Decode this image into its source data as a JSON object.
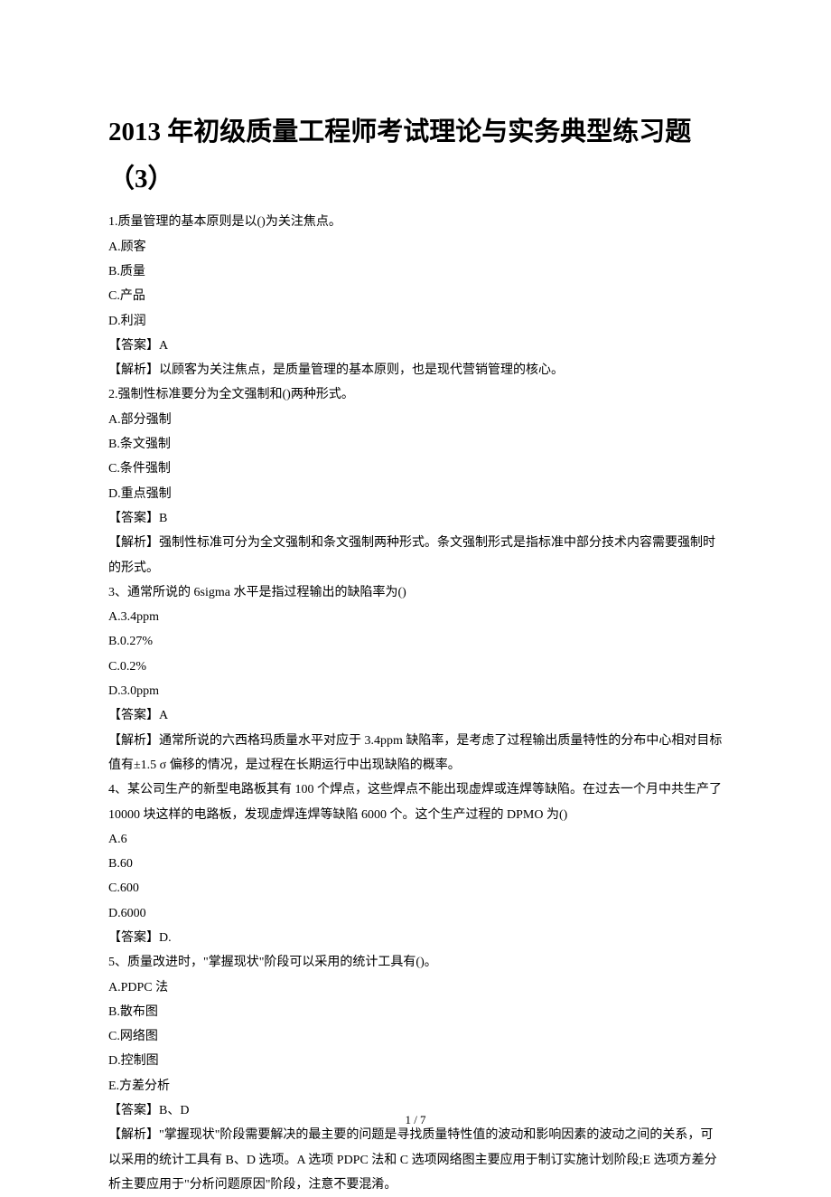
{
  "title": "2013 年初级质量工程师考试理论与实务典型练习题（3）",
  "page_num": "1 / 7",
  "lines": [
    "1.质量管理的基本原则是以()为关注焦点。",
    "A.顾客",
    "B.质量",
    "C.产品",
    "D.利润",
    "【答案】A",
    "【解析】以顾客为关注焦点，是质量管理的基本原则，也是现代营销管理的核心。",
    "2.强制性标准要分为全文强制和()两种形式。",
    "A.部分强制",
    "B.条文强制",
    "C.条件强制",
    "D.重点强制",
    "【答案】B",
    "【解析】强制性标准可分为全文强制和条文强制两种形式。条文强制形式是指标准中部分技术内容需要强制时的形式。",
    "3、通常所说的 6sigma 水平是指过程输出的缺陷率为()",
    "A.3.4ppm",
    "B.0.27%",
    "C.0.2%",
    "D.3.0ppm",
    "【答案】A",
    "【解析】通常所说的六西格玛质量水平对应于 3.4ppm 缺陷率，是考虑了过程输出质量特性的分布中心相对目标值有±1.5 σ 偏移的情况，是过程在长期运行中出现缺陷的概率。",
    "4、某公司生产的新型电路板其有 100 个焊点，这些焊点不能出现虚焊或连焊等缺陷。在过去一个月中共生产了 10000 块这样的电路板，发现虚焊连焊等缺陷 6000 个。这个生产过程的 DPMO 为()",
    "A.6",
    "B.60",
    "C.600",
    "D.6000",
    "【答案】D.",
    "5、质量改进时，\"掌握现状\"阶段可以采用的统计工具有()。",
    "A.PDPC 法",
    "B.散布图",
    "C.网络图",
    "D.控制图",
    "E.方差分析",
    "【答案】B、D",
    "【解析】\"掌握现状\"阶段需要解决的最主要的问题是寻找质量特性值的波动和影响因素的波动之间的关系，可以采用的统计工具有 B、D 选项。A 选项 PDPC 法和 C 选项网络图主要应用于制订实施计划阶段;E 选项方差分析主要应用于\"分析问题原因\"阶段，注意不要混淆。"
  ]
}
